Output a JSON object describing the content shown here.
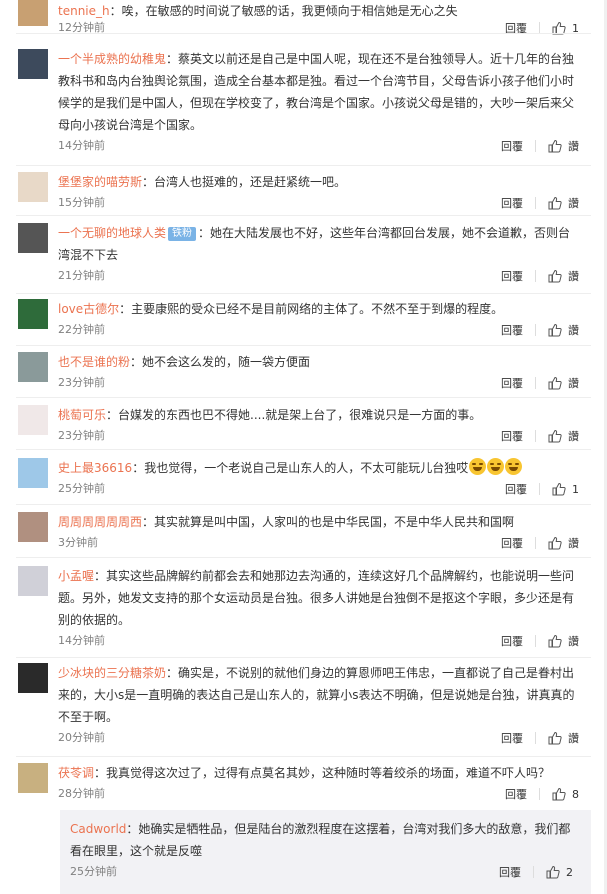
{
  "reply_label": "回覆",
  "like_fallback": "讚",
  "comments": [
    {
      "user": "tennie_h",
      "badge": "",
      "text": "：唉，在敏感的时间说了敏感的话，我更倾向于相信她是无心之失",
      "time": "12分钟前",
      "likes": "1",
      "avatar": "#c8a072"
    },
    {
      "user": "一个半成熟的幼稚鬼",
      "badge": "",
      "text": "：蔡英文以前还是自己是中国人呢，现在还不是台独领导人。近十几年的台独教科书和岛内台独舆论氛围，造成全台基本都是独。看过一个台湾节目，父母告诉小孩子他们小时候学的是我们是中国人，但现在学校变了，教台湾是个国家。小孩说父母是错的，大吵一架后来父母向小孩说台湾是个国家。",
      "time": "14分钟前",
      "likes": "讚",
      "avatar": "#3d4a5c"
    },
    {
      "user": "堡堡家的喵劳斯",
      "badge": "",
      "text": "：台湾人也挺难的，还是赶紧统一吧。",
      "time": "15分钟前",
      "likes": "讚",
      "avatar": "#e8d9c8"
    },
    {
      "user": "一个无聊的地球人类",
      "badge": "铁粉",
      "text": "：她在大陆发展也不好，这些年台湾都回台发展，她不会道歉，否则台湾混不下去",
      "time": "21分钟前",
      "likes": "讚",
      "avatar": "#555555"
    },
    {
      "user": "love古德尔",
      "badge": "",
      "text": "：主要康熙的受众已经不是目前网络的主体了。不然不至于到爆的程度。",
      "time": "22分钟前",
      "likes": "讚",
      "avatar": "#2e6b3a"
    },
    {
      "user": "也不是谁的粉",
      "badge": "",
      "text": "：她不会这么发的，随一袋方便面",
      "time": "23分钟前",
      "likes": "讚",
      "avatar": "#8a9a9a"
    },
    {
      "user": "桃萄可乐",
      "badge": "",
      "text": "：台媒发的东西也巴不得她....就是架上台了，很难说只是一方面的事。",
      "time": "23分钟前",
      "likes": "讚",
      "avatar": "#f0e8e8"
    },
    {
      "user": "史上最36616",
      "badge": "",
      "text": "：我也觉得，一个老说自己是山东人的人，不太可能玩儿台独哎",
      "time": "25分钟前",
      "likes": "1",
      "avatar": "#9ec8e8",
      "emojis": 3
    },
    {
      "user": "周周周周周周西",
      "badge": "",
      "text": "：其实就算是叫中国，人家叫的也是中华民国，不是中华人民共和国啊",
      "time": "3分钟前",
      "likes": "讚",
      "avatar": "#b09080"
    },
    {
      "user": "小孟喔",
      "badge": "",
      "text": "：其实这些品牌解约前都会去和她那边去沟通的，连续这好几个品牌解约，也能说明一些问题。另外，她发文支持的那个女运动员是台独。很多人讲她是台独倒不是抠这个字眼，多少还是有别的依据的。",
      "time": "14分钟前",
      "likes": "讚",
      "avatar": "#d0d0d8"
    },
    {
      "user": "少冰块的三分糖茶奶",
      "badge": "",
      "text": "：确实是，不说别的就他们身边的算恩师吧王伟忠，一直都说了自己是眷村出来的，大小s是一直明确的表达自己是山东人的，就算小s表达不明确，但是说她是台独，讲真真的不至于啊。",
      "time": "20分钟前",
      "likes": "讚",
      "avatar": "#2a2a2a"
    },
    {
      "user": "茯苓调",
      "badge": "",
      "text": "：我真觉得这次过了，过得有点莫名其妙，这种随时等着绞杀的场面，难道不吓人吗？",
      "time": "28分钟前",
      "likes": "8",
      "avatar": "#c8b080"
    }
  ],
  "subreply": {
    "user": "Cadworld",
    "text": "：她确实是牺牲品，但是陆台的激烈程度在这摆着，台湾对我们多大的敌意，我们都看在眼里，这个就是反噬",
    "time": "25分钟前",
    "likes": "2"
  }
}
